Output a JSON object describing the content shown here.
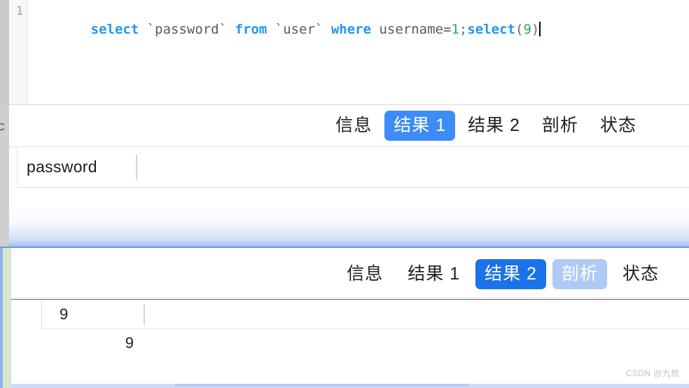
{
  "editor": {
    "line_number": "1",
    "sql_tokens": [
      {
        "text": "select",
        "type": "keyword"
      },
      {
        "text": " `password` ",
        "type": "identifier"
      },
      {
        "text": "from",
        "type": "keyword"
      },
      {
        "text": " `user` ",
        "type": "identifier"
      },
      {
        "text": "where",
        "type": "keyword"
      },
      {
        "text": " username=",
        "type": "identifier"
      },
      {
        "text": "1",
        "type": "number"
      },
      {
        "text": ";",
        "type": "punctuation"
      },
      {
        "text": "select",
        "type": "keyword"
      },
      {
        "text": "(",
        "type": "punctuation"
      },
      {
        "text": "9",
        "type": "number"
      },
      {
        "text": ")",
        "type": "punctuation"
      }
    ],
    "sql_full_text": "select `password` from `user` where username=1;select(9)",
    "caret_visible": true
  },
  "window_a": {
    "tabs": [
      {
        "label": "信息",
        "state": "normal"
      },
      {
        "label": "结果 1",
        "state": "active"
      },
      {
        "label": "结果 2",
        "state": "normal"
      },
      {
        "label": "剖析",
        "state": "normal"
      },
      {
        "label": "状态",
        "state": "normal"
      }
    ],
    "grid": {
      "columns": [
        "password"
      ],
      "rows": [
        [
          ""
        ]
      ]
    }
  },
  "window_b": {
    "tabs": [
      {
        "label": "信息",
        "state": "normal"
      },
      {
        "label": "结果 1",
        "state": "normal"
      },
      {
        "label": "结果 2",
        "state": "active"
      },
      {
        "label": "剖析",
        "state": "hover"
      },
      {
        "label": "状态",
        "state": "normal"
      }
    ],
    "grid": {
      "columns": [
        "9"
      ],
      "rows": [
        [
          "9"
        ]
      ]
    }
  },
  "chrome": {
    "partial_glyph": "C"
  },
  "watermark": {
    "text": "CSDN @九枕"
  },
  "colors": {
    "keyword": "#2196f3",
    "number": "#2eaa4e",
    "identifier": "#5a5a5a",
    "tab_active_a": "#3d8bf7",
    "tab_active_b": "#1a73e8",
    "tab_hover_b": "#aecbf5",
    "window_b_border": "#6f94e8",
    "gutter_bg": "#f7f7f7"
  }
}
